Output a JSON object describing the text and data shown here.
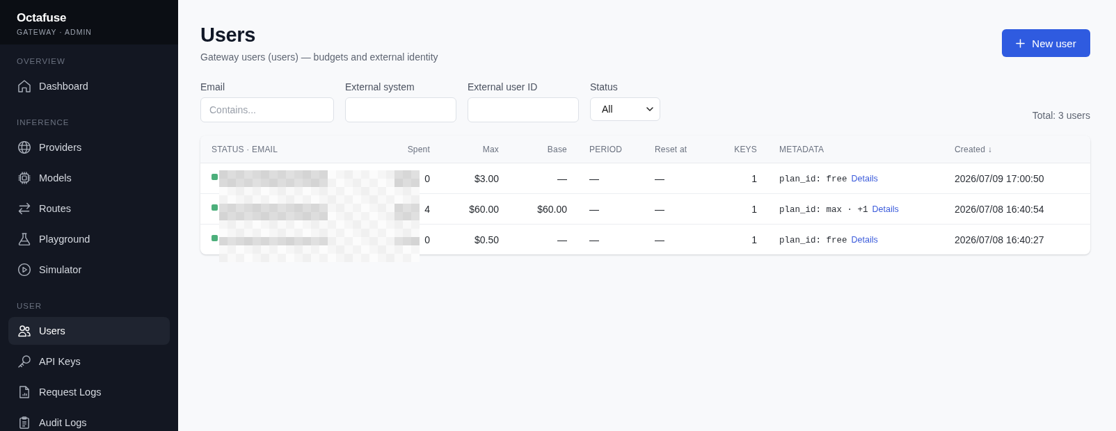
{
  "sidebar": {
    "brand": "Octafuse",
    "subtitle": "GATEWAY · ADMIN",
    "sections": [
      {
        "title": "OVERVIEW",
        "items": [
          {
            "label": "Dashboard",
            "selected": false
          }
        ]
      },
      {
        "title": "INFERENCE",
        "items": [
          {
            "label": "Providers",
            "selected": false
          },
          {
            "label": "Models",
            "selected": false
          },
          {
            "label": "Routes",
            "selected": false
          },
          {
            "label": "Playground",
            "selected": false
          },
          {
            "label": "Simulator",
            "selected": false
          }
        ]
      },
      {
        "title": "USER",
        "items": [
          {
            "label": "Users",
            "selected": true
          },
          {
            "label": "API Keys",
            "selected": false
          },
          {
            "label": "Request Logs",
            "selected": false
          },
          {
            "label": "Audit Logs",
            "selected": false
          }
        ]
      }
    ]
  },
  "header": {
    "title": "Users",
    "subtitle": "Gateway users (users) — budgets and external identity",
    "new_button": "New user"
  },
  "filters": [
    {
      "kind": "text",
      "label": "Email",
      "placeholder": "Contains..."
    },
    {
      "kind": "text",
      "label": "External system"
    },
    {
      "kind": "text",
      "label": "External user ID"
    },
    {
      "kind": "select",
      "label": "Status",
      "value": "All"
    }
  ],
  "total": "Total: 3 users",
  "table": {
    "redacted": true,
    "columns": [
      "STATUS · EMAIL",
      "Spent",
      "Max",
      "Base",
      "PERIOD",
      "Reset at",
      "KEYS",
      "METADATA",
      "Created ↓"
    ],
    "rows": [
      {
        "color": "#4caf7b",
        "spent": "0",
        "max": "$3.00",
        "base": "—",
        "period": "—",
        "reset_at": "—",
        "keys": "1",
        "metadata": "plan_id: free",
        "details": "Details",
        "created": "2026/07/09 17:00:50"
      },
      {
        "color": "#4caf7b",
        "spent": "4",
        "max": "$60.00",
        "base": "$60.00",
        "period": "—",
        "reset_at": "—",
        "keys": "1",
        "metadata": "plan_id: max · +1",
        "details": "Details",
        "created": "2026/07/08 16:40:54"
      },
      {
        "color": "#4caf7b",
        "spent": "0",
        "max": "$0.50",
        "base": "—",
        "period": "—",
        "reset_at": "—",
        "keys": "1",
        "metadata": "plan_id: free",
        "details": "Details",
        "created": "2026/07/08 16:40:27"
      }
    ]
  }
}
